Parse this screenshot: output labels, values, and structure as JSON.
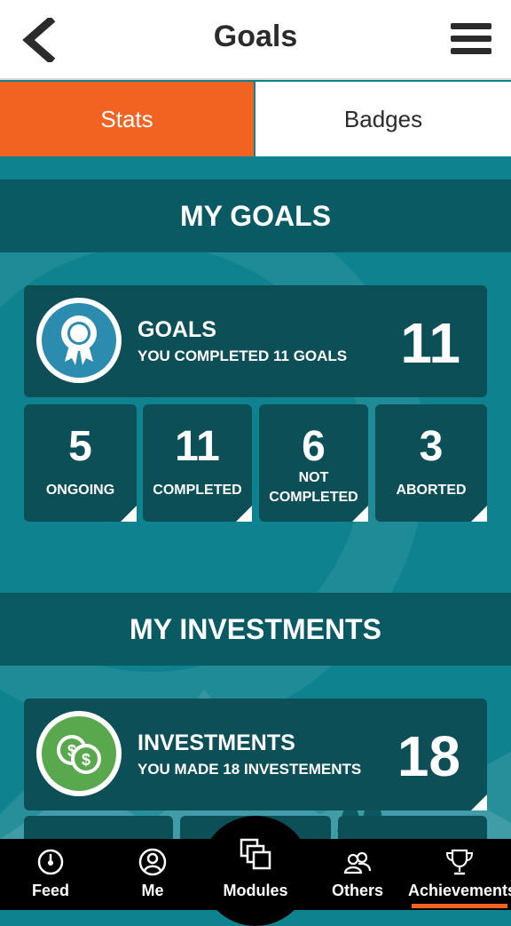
{
  "header": {
    "title": "Goals",
    "back_icon": "chevron-left-icon",
    "menu_icon": "hamburger-menu-icon"
  },
  "tabs": [
    {
      "label": "Stats",
      "active": true
    },
    {
      "label": "Badges",
      "active": false
    }
  ],
  "colors": {
    "accent": "#f26322",
    "teal": "#0e838f",
    "dark_teal": "#0a5a63",
    "card": "#0c4f57",
    "goals_badge": "#2b8cb0",
    "investments_badge": "#5aa84e"
  },
  "goals": {
    "section_title": "MY GOALS",
    "summary": {
      "label": "GOALS",
      "subtitle": "YOU COMPLETED 11 GOALS",
      "value": "11",
      "icon": "award-ribbon-icon"
    },
    "stats": [
      {
        "value": "5",
        "label": "ONGOING"
      },
      {
        "value": "11",
        "label": "COMPLETED"
      },
      {
        "value": "6",
        "label": "NOT\nCOMPLETED"
      },
      {
        "value": "3",
        "label": "ABORTED"
      }
    ]
  },
  "investments": {
    "section_title": "MY INVESTMENTS",
    "summary": {
      "label": "INVESTMENTS",
      "subtitle": "YOU MADE 18 INVESTEMENTS",
      "value": "18",
      "icon": "coins-icon"
    }
  },
  "nav": [
    {
      "label": "Feed",
      "icon": "gauge-icon",
      "active": false
    },
    {
      "label": "Me",
      "icon": "person-icon",
      "active": false
    },
    {
      "label": "Modules",
      "icon": "modules-icon",
      "active": false
    },
    {
      "label": "Others",
      "icon": "people-icon",
      "active": false
    },
    {
      "label": "Achievements",
      "icon": "trophy-icon",
      "active": true
    }
  ]
}
